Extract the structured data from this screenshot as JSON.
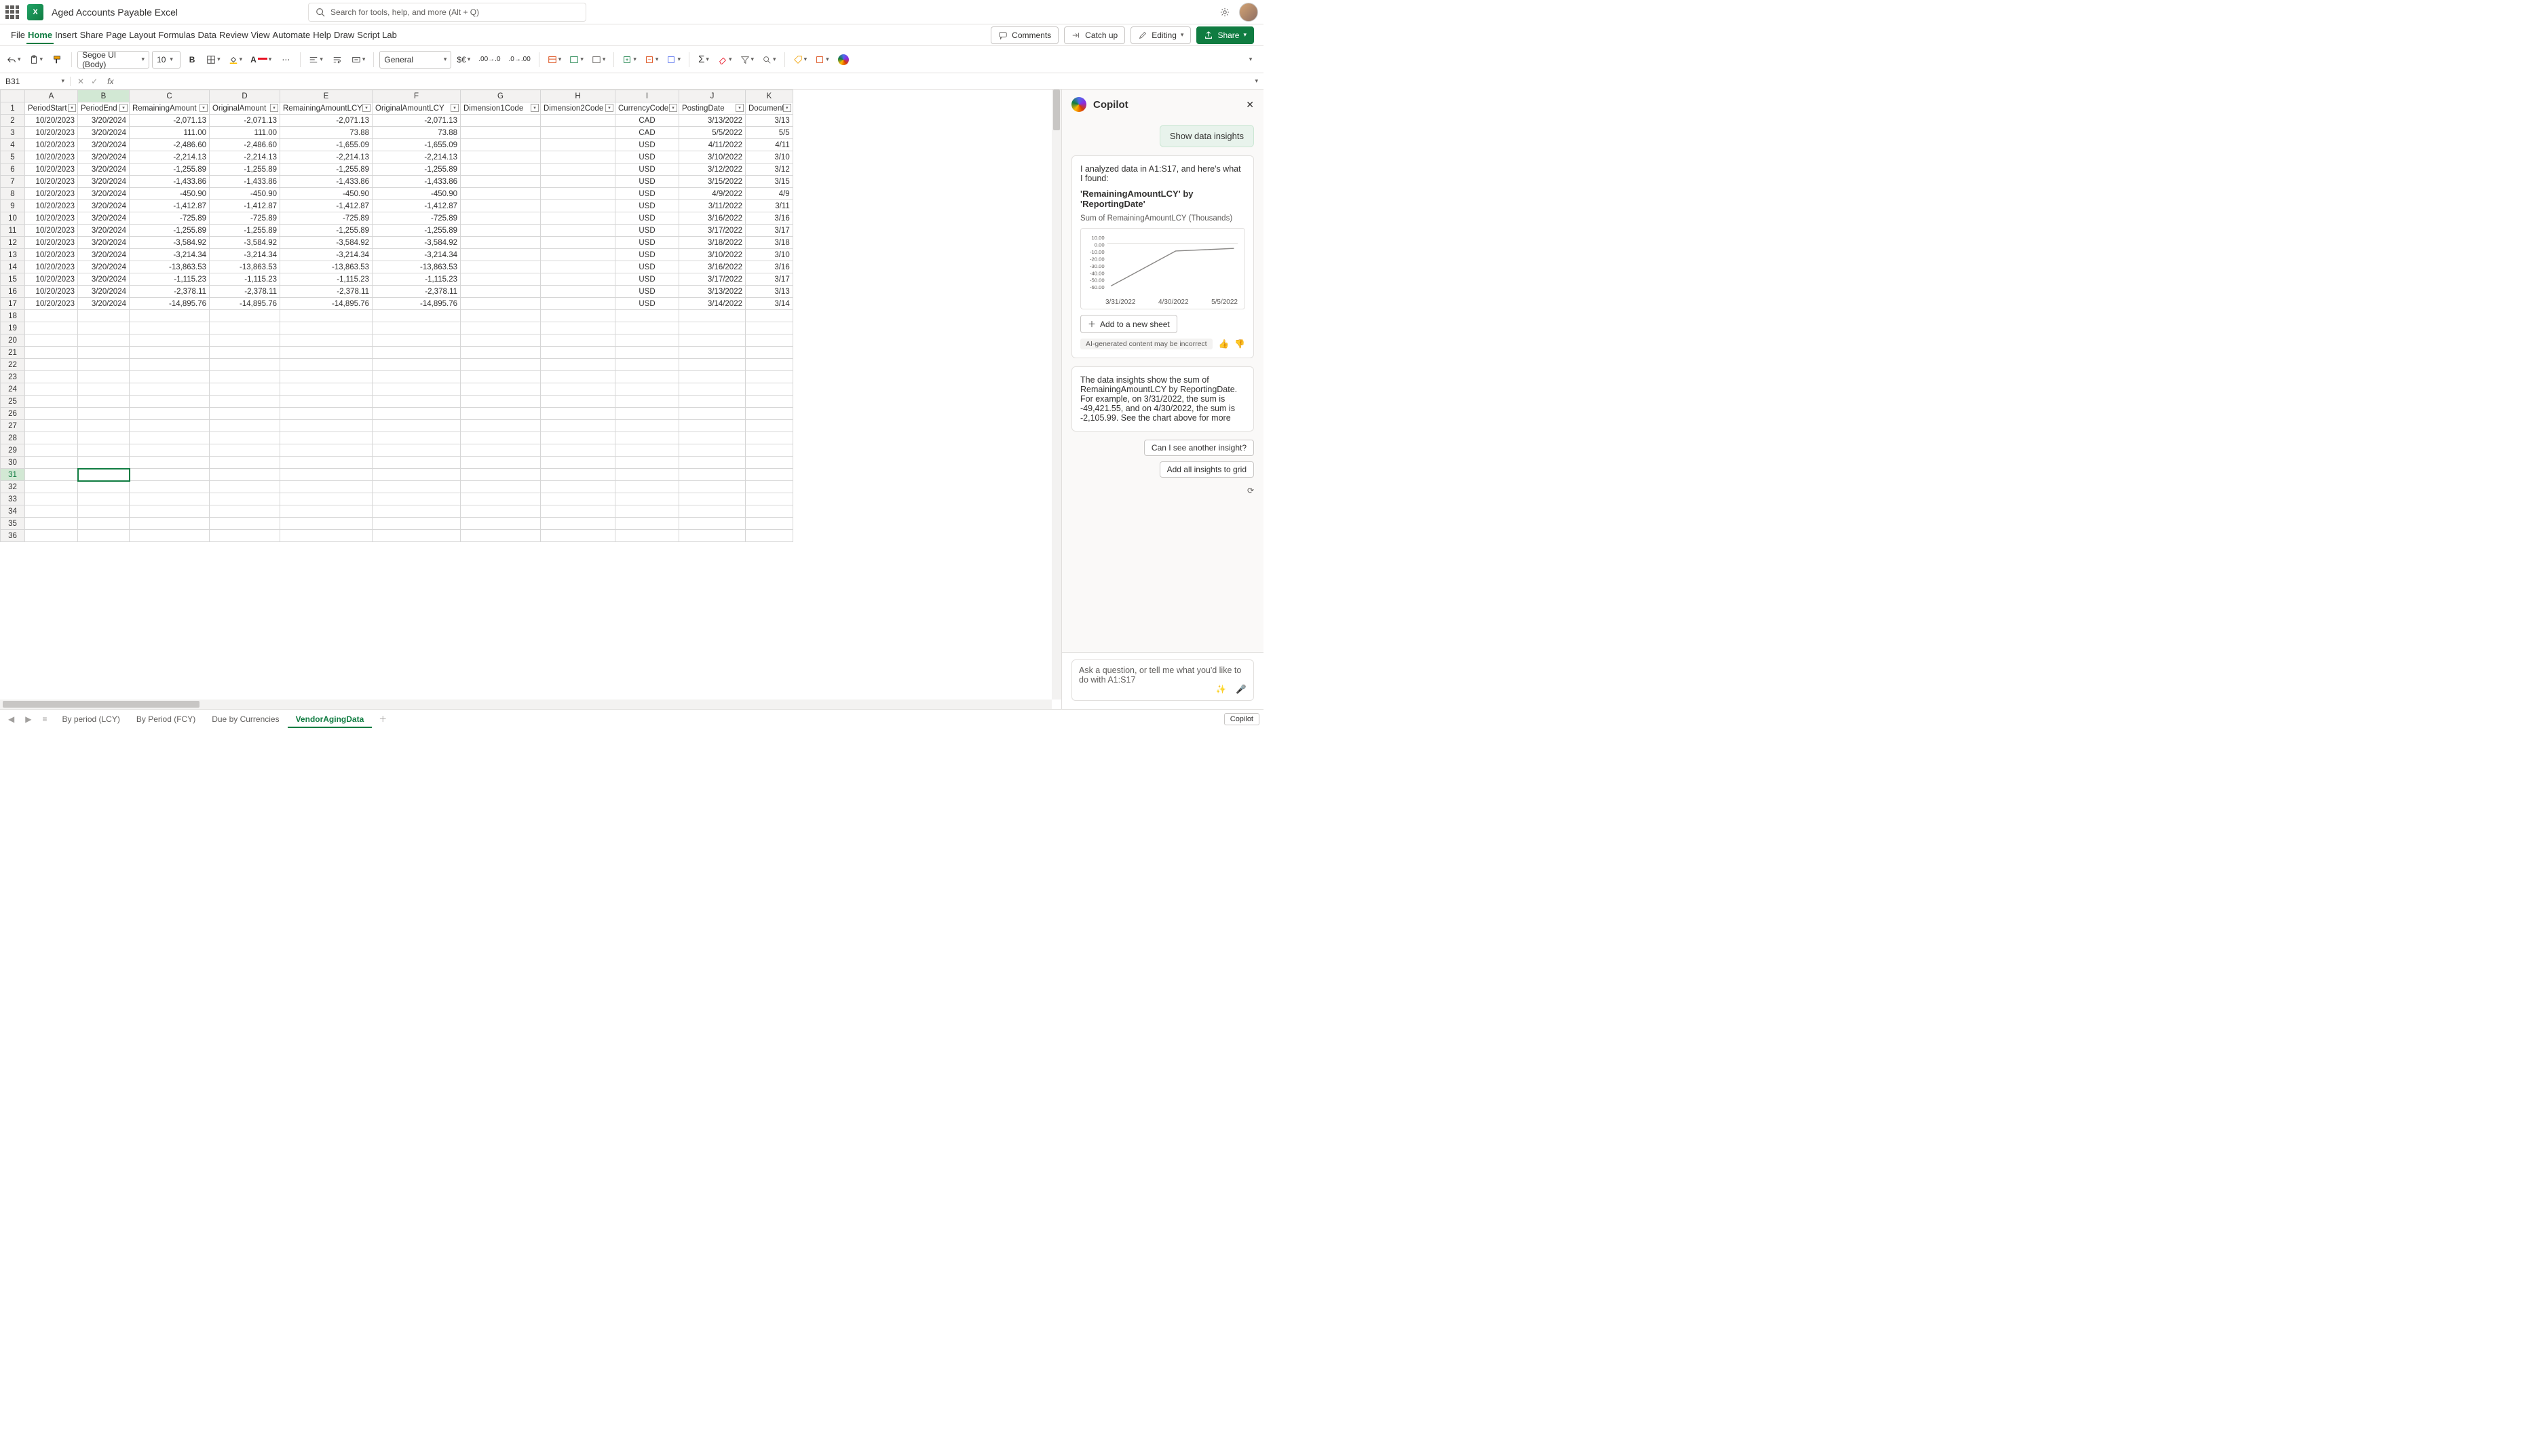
{
  "titlebar": {
    "doc_title": "Aged Accounts Payable Excel",
    "search_placeholder": "Search for tools, help, and more (Alt + Q)"
  },
  "menubar": {
    "items": [
      "File",
      "Home",
      "Insert",
      "Share",
      "Page Layout",
      "Formulas",
      "Data",
      "Review",
      "View",
      "Automate",
      "Help",
      "Draw",
      "Script Lab"
    ],
    "active_index": 1,
    "right": {
      "comments": "Comments",
      "catchup": "Catch up",
      "editing": "Editing",
      "share": "Share"
    }
  },
  "ribbon": {
    "font_family": "Segoe UI (Body)",
    "font_size": "10",
    "number_format": "General"
  },
  "formula_bar": {
    "name_box": "B31",
    "fx_value": ""
  },
  "columns": {
    "letters": [
      "A",
      "B",
      "C",
      "D",
      "E",
      "F",
      "G",
      "H",
      "I",
      "J",
      "K"
    ],
    "widths": [
      78,
      76,
      118,
      104,
      136,
      130,
      118,
      110,
      94,
      98,
      66
    ],
    "headers": [
      "PeriodStart",
      "PeriodEnd",
      "RemainingAmount",
      "OriginalAmount",
      "RemainingAmountLCY",
      "OriginalAmountLCY",
      "Dimension1Code",
      "Dimension2Code",
      "CurrencyCode",
      "PostingDate",
      "DocumentD"
    ]
  },
  "rows": [
    {
      "n": 2,
      "A": "10/20/2023",
      "B": "3/20/2024",
      "C": "-2,071.13",
      "D": "-2,071.13",
      "E": "-2,071.13",
      "F": "-2,071.13",
      "G": "",
      "H": "",
      "I": "CAD",
      "J": "3/13/2022",
      "K": "3/13"
    },
    {
      "n": 3,
      "A": "10/20/2023",
      "B": "3/20/2024",
      "C": "111.00",
      "D": "111.00",
      "E": "73.88",
      "F": "73.88",
      "G": "",
      "H": "",
      "I": "CAD",
      "J": "5/5/2022",
      "K": "5/5"
    },
    {
      "n": 4,
      "A": "10/20/2023",
      "B": "3/20/2024",
      "C": "-2,486.60",
      "D": "-2,486.60",
      "E": "-1,655.09",
      "F": "-1,655.09",
      "G": "",
      "H": "",
      "I": "USD",
      "J": "4/11/2022",
      "K": "4/11"
    },
    {
      "n": 5,
      "A": "10/20/2023",
      "B": "3/20/2024",
      "C": "-2,214.13",
      "D": "-2,214.13",
      "E": "-2,214.13",
      "F": "-2,214.13",
      "G": "",
      "H": "",
      "I": "USD",
      "J": "3/10/2022",
      "K": "3/10"
    },
    {
      "n": 6,
      "A": "10/20/2023",
      "B": "3/20/2024",
      "C": "-1,255.89",
      "D": "-1,255.89",
      "E": "-1,255.89",
      "F": "-1,255.89",
      "G": "",
      "H": "",
      "I": "USD",
      "J": "3/12/2022",
      "K": "3/12"
    },
    {
      "n": 7,
      "A": "10/20/2023",
      "B": "3/20/2024",
      "C": "-1,433.86",
      "D": "-1,433.86",
      "E": "-1,433.86",
      "F": "-1,433.86",
      "G": "",
      "H": "",
      "I": "USD",
      "J": "3/15/2022",
      "K": "3/15"
    },
    {
      "n": 8,
      "A": "10/20/2023",
      "B": "3/20/2024",
      "C": "-450.90",
      "D": "-450.90",
      "E": "-450.90",
      "F": "-450.90",
      "G": "",
      "H": "",
      "I": "USD",
      "J": "4/9/2022",
      "K": "4/9"
    },
    {
      "n": 9,
      "A": "10/20/2023",
      "B": "3/20/2024",
      "C": "-1,412.87",
      "D": "-1,412.87",
      "E": "-1,412.87",
      "F": "-1,412.87",
      "G": "",
      "H": "",
      "I": "USD",
      "J": "3/11/2022",
      "K": "3/11"
    },
    {
      "n": 10,
      "A": "10/20/2023",
      "B": "3/20/2024",
      "C": "-725.89",
      "D": "-725.89",
      "E": "-725.89",
      "F": "-725.89",
      "G": "",
      "H": "",
      "I": "USD",
      "J": "3/16/2022",
      "K": "3/16"
    },
    {
      "n": 11,
      "A": "10/20/2023",
      "B": "3/20/2024",
      "C": "-1,255.89",
      "D": "-1,255.89",
      "E": "-1,255.89",
      "F": "-1,255.89",
      "G": "",
      "H": "",
      "I": "USD",
      "J": "3/17/2022",
      "K": "3/17"
    },
    {
      "n": 12,
      "A": "10/20/2023",
      "B": "3/20/2024",
      "C": "-3,584.92",
      "D": "-3,584.92",
      "E": "-3,584.92",
      "F": "-3,584.92",
      "G": "",
      "H": "",
      "I": "USD",
      "J": "3/18/2022",
      "K": "3/18"
    },
    {
      "n": 13,
      "A": "10/20/2023",
      "B": "3/20/2024",
      "C": "-3,214.34",
      "D": "-3,214.34",
      "E": "-3,214.34",
      "F": "-3,214.34",
      "G": "",
      "H": "",
      "I": "USD",
      "J": "3/10/2022",
      "K": "3/10"
    },
    {
      "n": 14,
      "A": "10/20/2023",
      "B": "3/20/2024",
      "C": "-13,863.53",
      "D": "-13,863.53",
      "E": "-13,863.53",
      "F": "-13,863.53",
      "G": "",
      "H": "",
      "I": "USD",
      "J": "3/16/2022",
      "K": "3/16"
    },
    {
      "n": 15,
      "A": "10/20/2023",
      "B": "3/20/2024",
      "C": "-1,115.23",
      "D": "-1,115.23",
      "E": "-1,115.23",
      "F": "-1,115.23",
      "G": "",
      "H": "",
      "I": "USD",
      "J": "3/17/2022",
      "K": "3/17"
    },
    {
      "n": 16,
      "A": "10/20/2023",
      "B": "3/20/2024",
      "C": "-2,378.11",
      "D": "-2,378.11",
      "E": "-2,378.11",
      "F": "-2,378.11",
      "G": "",
      "H": "",
      "I": "USD",
      "J": "3/13/2022",
      "K": "3/13"
    },
    {
      "n": 17,
      "A": "10/20/2023",
      "B": "3/20/2024",
      "C": "-14,895.76",
      "D": "-14,895.76",
      "E": "-14,895.76",
      "F": "-14,895.76",
      "G": "",
      "H": "",
      "I": "USD",
      "J": "3/14/2022",
      "K": "3/14"
    }
  ],
  "empty_row_start": 18,
  "empty_row_end": 36,
  "selected_cell": {
    "row": 31,
    "col": "B"
  },
  "sheet_tabs": {
    "tabs": [
      "By period (LCY)",
      "By Period (FCY)",
      "Due by Currencies",
      "VendorAgingData"
    ],
    "active_index": 3,
    "copilot_badge": "Copilot"
  },
  "copilot": {
    "title": "Copilot",
    "user_prompt": "Show data insights",
    "intro": "I analyzed data in A1:S17, and here's what I found:",
    "insight_title": "'RemainingAmountLCY' by 'ReportingDate'",
    "insight_sub": "Sum of RemainingAmountLCY (Thousands)",
    "chart_y_ticks": [
      "10.00",
      "0.00",
      "-10.00",
      "-20.00",
      "-30.00",
      "-40.00",
      "-50.00",
      "-60.00"
    ],
    "chart_x_ticks": [
      "3/31/2022",
      "4/30/2022",
      "5/5/2022"
    ],
    "add_sheet": "Add to a new sheet",
    "disclaimer": "AI-generated content may be incorrect",
    "body_text": "The data insights show the sum of RemainingAmountLCY by ReportingDate. For example, on 3/31/2022, the sum is -49,421.55, and on 4/30/2022, the sum is -2,105.99. See the chart above for more",
    "suggest1": "Can I see another insight?",
    "suggest2": "Add all insights to grid",
    "input_placeholder": "Ask a question, or tell me what you'd like to do with A1:S17"
  },
  "chart_data": {
    "type": "line",
    "title": "'RemainingAmountLCY' by 'ReportingDate'",
    "ylabel": "Sum of RemainingAmountLCY (Thousands)",
    "x": [
      "3/31/2022",
      "4/30/2022",
      "5/5/2022"
    ],
    "values": [
      -49.42,
      -2.11,
      0.07
    ],
    "ylim": [
      -60,
      10
    ]
  }
}
